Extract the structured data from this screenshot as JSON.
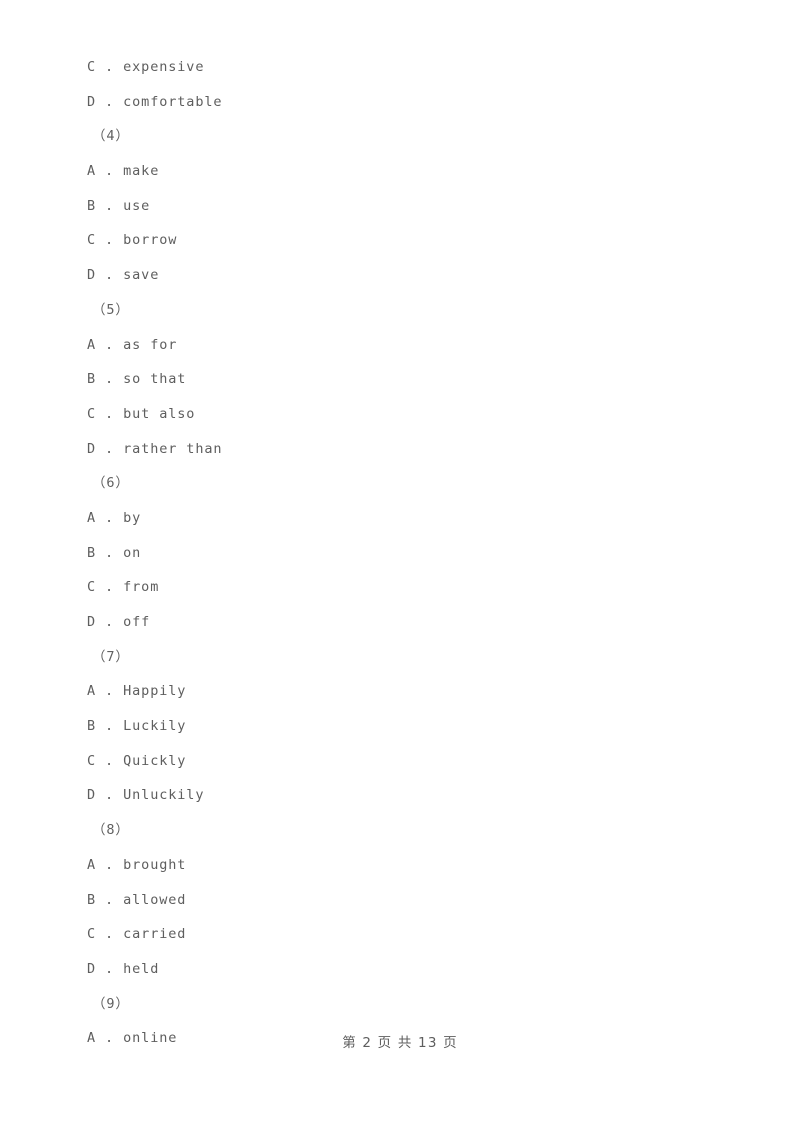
{
  "document": {
    "background_color": "#ffffff",
    "text_color": "#5e5e5e"
  },
  "body_lines": [
    {
      "kind": "option",
      "text": "C . expensive"
    },
    {
      "kind": "option",
      "text": "D . comfortable"
    },
    {
      "kind": "group",
      "text": "（4）"
    },
    {
      "kind": "option",
      "text": "A . make"
    },
    {
      "kind": "option",
      "text": "B . use"
    },
    {
      "kind": "option",
      "text": "C . borrow"
    },
    {
      "kind": "option",
      "text": "D . save"
    },
    {
      "kind": "group",
      "text": "（5）"
    },
    {
      "kind": "option",
      "text": "A . as for"
    },
    {
      "kind": "option",
      "text": "B . so that"
    },
    {
      "kind": "option",
      "text": "C . but also"
    },
    {
      "kind": "option",
      "text": "D . rather than"
    },
    {
      "kind": "group",
      "text": "（6）"
    },
    {
      "kind": "option",
      "text": "A . by"
    },
    {
      "kind": "option",
      "text": "B . on"
    },
    {
      "kind": "option",
      "text": "C . from"
    },
    {
      "kind": "option",
      "text": "D . off"
    },
    {
      "kind": "group",
      "text": "（7）"
    },
    {
      "kind": "option",
      "text": "A . Happily"
    },
    {
      "kind": "option",
      "text": "B . Luckily"
    },
    {
      "kind": "option",
      "text": "C . Quickly"
    },
    {
      "kind": "option",
      "text": "D . Unluckily"
    },
    {
      "kind": "group",
      "text": "（8）"
    },
    {
      "kind": "option",
      "text": "A . brought"
    },
    {
      "kind": "option",
      "text": "B . allowed"
    },
    {
      "kind": "option",
      "text": "C . carried"
    },
    {
      "kind": "option",
      "text": "D . held"
    },
    {
      "kind": "group",
      "text": "（9）"
    },
    {
      "kind": "option",
      "text": "A . online"
    }
  ],
  "footer": {
    "text": "第 2 页 共 13 页",
    "current_page": "2",
    "total_pages": "13"
  }
}
